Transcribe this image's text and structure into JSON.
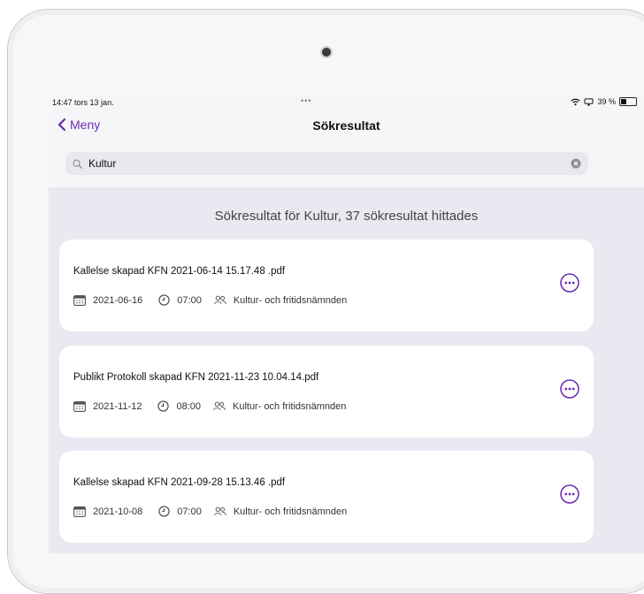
{
  "status": {
    "time": "14:47",
    "date": "tors 13 jan.",
    "dots": "•••",
    "battery": "39 %",
    "battery_level": 0.39
  },
  "nav": {
    "back_label": "Meny",
    "title": "Sökresultat"
  },
  "search": {
    "value": "Kultur"
  },
  "results_heading": "Sökresultat för Kultur, 37 sökresultat hittades",
  "results": [
    {
      "title": "Kallelse skapad KFN 2021-06-14 15.17.48 .pdf",
      "date": "2021-06-16",
      "time": "07:00",
      "committee": "Kultur- och fritidsnämnden"
    },
    {
      "title": "Publikt Protokoll skapad KFN 2021-11-23 10.04.14.pdf",
      "date": "2021-11-12",
      "time": "08:00",
      "committee": "Kultur- och fritidsnämnden"
    },
    {
      "title": "Kallelse skapad KFN 2021-09-28 15.13.46 .pdf",
      "date": "2021-10-08",
      "time": "07:00",
      "committee": "Kultur- och fritidsnämnden"
    }
  ],
  "colors": {
    "accent": "#6a2bb4",
    "background": "#e9e9f1",
    "card": "#ffffff"
  },
  "icons": [
    "chevron-left-icon",
    "search-icon",
    "clear-icon",
    "calendar-icon",
    "clock-icon",
    "people-icon",
    "more-icon",
    "wifi-icon",
    "screen-mirror-icon",
    "battery-icon"
  ]
}
